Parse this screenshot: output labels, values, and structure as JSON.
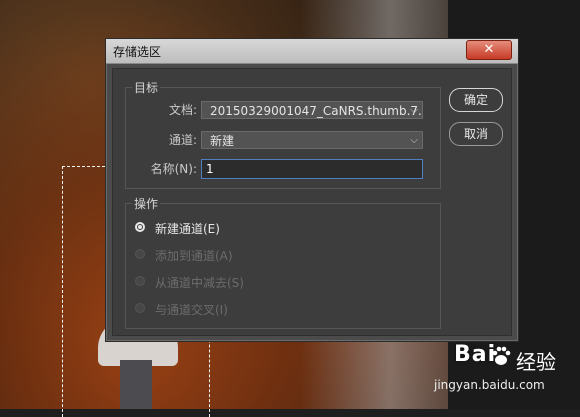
{
  "dialog": {
    "title": "存储选区",
    "close_symbol": "✕",
    "target_group_label": "目标",
    "document_label": "文档:",
    "document_value": "20150329001047_CaNRS.thumb.7...",
    "channel_label": "通道:",
    "channel_value": "新建",
    "name_label": "名称(N):",
    "name_value": "1",
    "operation_group_label": "操作",
    "operations": [
      {
        "label": "新建通道(E)",
        "selected": true
      },
      {
        "label": "添加到通道(A)",
        "selected": false
      },
      {
        "label": "从通道中减去(S)",
        "selected": false
      },
      {
        "label": "与通道交叉(I)",
        "selected": false
      }
    ],
    "ok_label": "确定",
    "cancel_label": "取消"
  },
  "watermark": {
    "logo_text": "Bai",
    "logo_text2": "经验",
    "url": "jingyan.baidu.com"
  },
  "icons": {
    "close": "close-icon",
    "dropdown": "chevron-down-icon",
    "paw": "baidu-paw-icon"
  }
}
